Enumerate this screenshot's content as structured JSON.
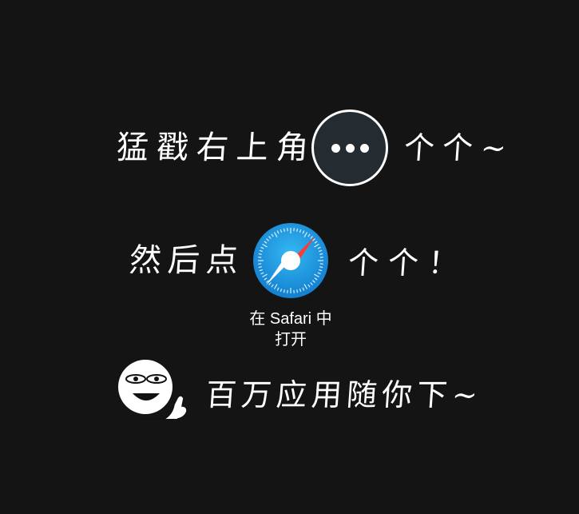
{
  "step1": {
    "text": "猛戳右上角",
    "suffix": "个个~",
    "button_icon": "more-dots-icon"
  },
  "step2": {
    "text": "然后点",
    "suffix": "个个！",
    "app_icon": "safari-compass-icon",
    "caption_line1": "在 Safari 中",
    "caption_line2": "打开"
  },
  "step3": {
    "mascot_icon": "thumbs-up-face-icon",
    "text": "百万应用随你下~"
  },
  "colors": {
    "background": "#141414",
    "text": "#ffffff",
    "button_bg": "#242b31",
    "safari_blue": "#1a9be0",
    "needle_red": "#ff3b30"
  }
}
